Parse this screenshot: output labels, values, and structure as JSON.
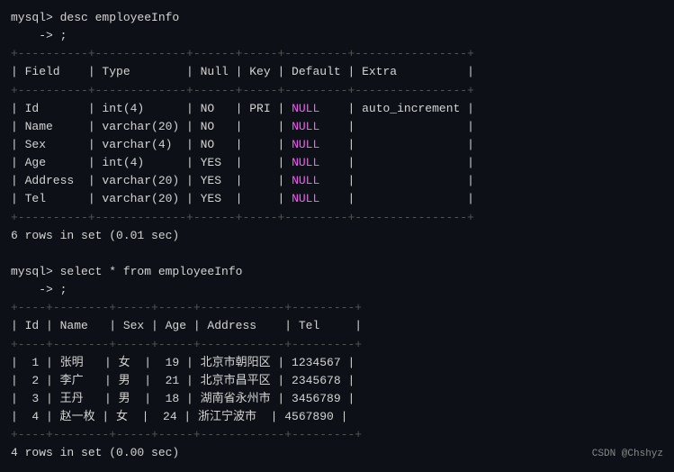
{
  "terminal": {
    "lines": [
      {
        "type": "prompt",
        "text": "mysql> desc employeeInfo"
      },
      {
        "type": "prompt",
        "text": "    -> ;"
      },
      {
        "type": "separator",
        "text": "+----------+-------------+------+-----+---------+----------------+"
      },
      {
        "type": "header",
        "text": "| Field    | Type        | Null | Key | Default | Extra          |"
      },
      {
        "type": "separator",
        "text": "+----------+-------------+------+-----+---------+----------------+"
      },
      {
        "type": "row_id",
        "text": "| Id       | int(4)      | NO   | PRI | NULL    | auto_increment |"
      },
      {
        "type": "row_name",
        "text": "| Name     | varchar(20) | NO   |     | NULL    |                |"
      },
      {
        "type": "row_sex",
        "text": "| Sex      | varchar(4)  | NO   |     | NULL    |                |"
      },
      {
        "type": "row_age",
        "text": "| Age      | int(4)      | YES  |     | NULL    |                |"
      },
      {
        "type": "row_addr",
        "text": "| Address  | varchar(20) | YES  |     | NULL    |                |"
      },
      {
        "type": "row_tel",
        "text": "| Tel      | varchar(20) | YES  |     | NULL    |                |"
      },
      {
        "type": "separator",
        "text": "+----------+-------------+------+-----+---------+----------------+"
      },
      {
        "type": "info",
        "text": "6 rows in set (0.01 sec)"
      },
      {
        "type": "blank",
        "text": ""
      },
      {
        "type": "prompt",
        "text": "mysql> select * from employeeInfo"
      },
      {
        "type": "prompt",
        "text": "    -> ;"
      },
      {
        "type": "separator2",
        "text": "+----+--------+-----+-----+------------+---------+"
      },
      {
        "type": "header2",
        "text": "| Id | Name   | Sex | Age | Address    | Tel     |"
      },
      {
        "type": "separator2",
        "text": "+----+--------+-----+-----+------------+---------+"
      },
      {
        "type": "data1",
        "text": "|  1 | 张明   | 女  |  19 | 北京市朝阳区 | 1234567 |"
      },
      {
        "type": "data2",
        "text": "|  2 | 李广   | 男  |  21 | 北京市昌平区 | 2345678 |"
      },
      {
        "type": "data3",
        "text": "|  3 | 王丹   | 男  |  18 | 湖南省永州市 | 3456789 |"
      },
      {
        "type": "data4",
        "text": "|  4 | 赵一枚 | 女  |  24 | 浙江宁波市  | 4567890 |"
      },
      {
        "type": "separator2",
        "text": "+----+--------+-----+-----+------------+---------+"
      },
      {
        "type": "info",
        "text": "4 rows in set (0.00 sec)"
      }
    ],
    "watermark": "CSDN @Chshyz"
  }
}
